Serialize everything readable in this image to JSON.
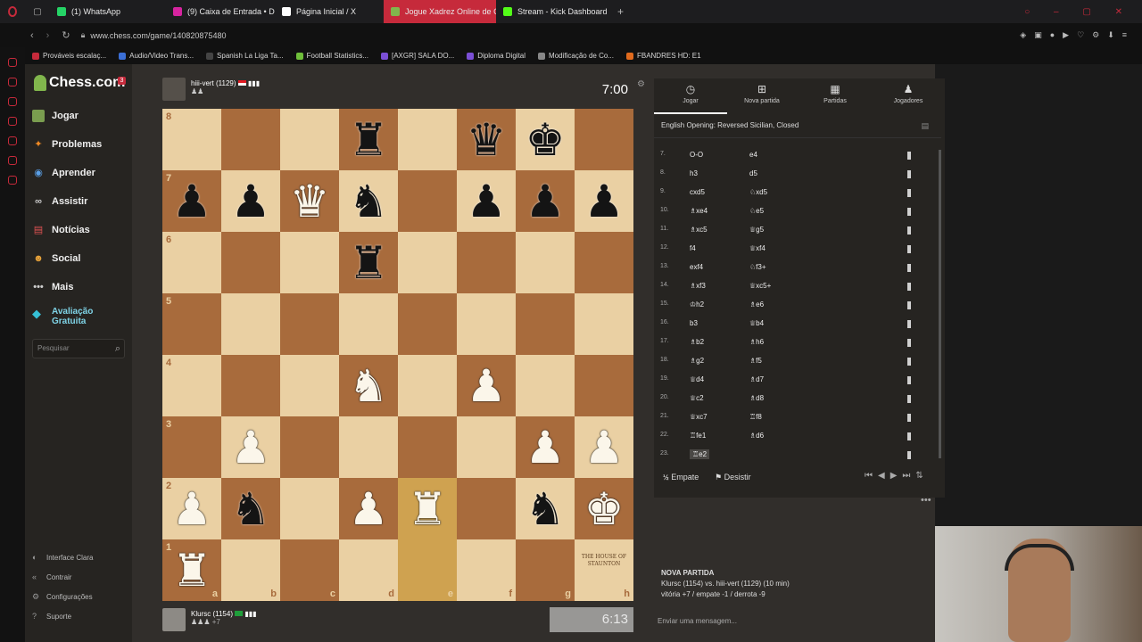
{
  "browser": {
    "tabs": [
      {
        "label": "(1) WhatsApp",
        "color": "#25d366"
      },
      {
        "label": "(9) Caixa de Entrada • Di",
        "color": "#d6249f"
      },
      {
        "label": "Página Inicial / X",
        "color": "#ffffff"
      },
      {
        "label": "Jogue Xadrez Online de G",
        "color": "#81b64c",
        "active": true
      },
      {
        "label": "Stream - Kick Dashboard",
        "color": "#53fc18"
      }
    ],
    "url": "www.chess.com/game/140820875480",
    "bookmarks": [
      "Prováveis escalaç...",
      "Audio/Video Trans...",
      "Spanish La Liga Ta...",
      "Football Statistics...",
      "[AXGR] SALA DO...",
      "Diploma Digital",
      "Modificação de Co...",
      "FBANDRES HD: E1"
    ]
  },
  "sidebar": {
    "logo": "Chess.com",
    "notif_count": "3",
    "items": [
      {
        "label": "Jogar",
        "icon": "board-icon"
      },
      {
        "label": "Problemas",
        "icon": "puzzle-icon"
      },
      {
        "label": "Aprender",
        "icon": "learn-icon"
      },
      {
        "label": "Assistir",
        "icon": "binoculars-icon"
      },
      {
        "label": "Notícias",
        "icon": "news-icon"
      },
      {
        "label": "Social",
        "icon": "social-icon"
      },
      {
        "label": "Mais",
        "icon": "more-icon"
      }
    ],
    "premium_line1": "Avaliação",
    "premium_line2": "Gratuita",
    "search_placeholder": "Pesquisar",
    "footer": [
      "Interface Clara",
      "Contrair",
      "Configurações",
      "Suporte"
    ]
  },
  "players": {
    "top": {
      "name": "hiii-vert (1129)",
      "clock": "7:00"
    },
    "bottom": {
      "name": "Klursc (1154)",
      "clock": "6:13",
      "extra": "+7"
    }
  },
  "board": {
    "files": [
      "a",
      "b",
      "c",
      "d",
      "e",
      "f",
      "g",
      "h"
    ],
    "ranks": [
      "8",
      "7",
      "6",
      "5",
      "4",
      "3",
      "2",
      "1"
    ],
    "board_logo_line1": "THE HOUSE OF",
    "board_logo_line2": "STAUNTON"
  },
  "panel": {
    "tabs": [
      {
        "label": "Jogar",
        "icon": "clock-icon"
      },
      {
        "label": "Nova partida",
        "icon": "plus-icon"
      },
      {
        "label": "Partidas",
        "icon": "board-icon"
      },
      {
        "label": "Jogadores",
        "icon": "players-icon"
      }
    ],
    "opening": "English Opening: Reversed Sicilian, Closed",
    "moves": [
      {
        "n": "7.",
        "w": "O-O",
        "b": "e4"
      },
      {
        "n": "8.",
        "w": "h3",
        "b": "d5"
      },
      {
        "n": "9.",
        "w": "cxd5",
        "b": "♘xd5"
      },
      {
        "n": "10.",
        "w": "♗xe4",
        "b": "♘e5"
      },
      {
        "n": "11.",
        "w": "♗xc5",
        "b": "♕g5"
      },
      {
        "n": "12.",
        "w": "f4",
        "b": "♕xf4"
      },
      {
        "n": "13.",
        "w": "exf4",
        "b": "♘f3+"
      },
      {
        "n": "14.",
        "w": "♗xf3",
        "b": "♕xc5+"
      },
      {
        "n": "15.",
        "w": "♔h2",
        "b": "♗e6"
      },
      {
        "n": "16.",
        "w": "b3",
        "b": "♕b4"
      },
      {
        "n": "17.",
        "w": "♗b2",
        "b": "♗h6"
      },
      {
        "n": "18.",
        "w": "♗g2",
        "b": "♗f5"
      },
      {
        "n": "19.",
        "w": "♕d4",
        "b": "♗d7"
      },
      {
        "n": "20.",
        "w": "♕c2",
        "b": "♗d8"
      },
      {
        "n": "21.",
        "w": "♕xc7",
        "b": "♖f8"
      },
      {
        "n": "22.",
        "w": "♖fe1",
        "b": "♗d6"
      },
      {
        "n": "23.",
        "w": "♖e2",
        "b": ""
      }
    ],
    "draw_label": "Empate",
    "resign_label": "Desistir"
  },
  "chat": {
    "title": "NOVA PARTIDA",
    "line1": "Klursc (1154) vs. hiii-vert (1129) (10 min)",
    "line2": "vitória +7 / empate -1 / derrota -9",
    "input_placeholder": "Enviar uma mensagem..."
  }
}
